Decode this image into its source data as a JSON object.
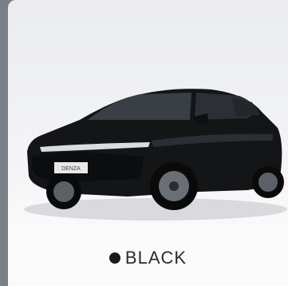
{
  "swatch": {
    "color": "#1a1a1a",
    "label": "BLACK"
  },
  "car": {
    "badge_text": "DENZA",
    "body_color": "#141517"
  }
}
